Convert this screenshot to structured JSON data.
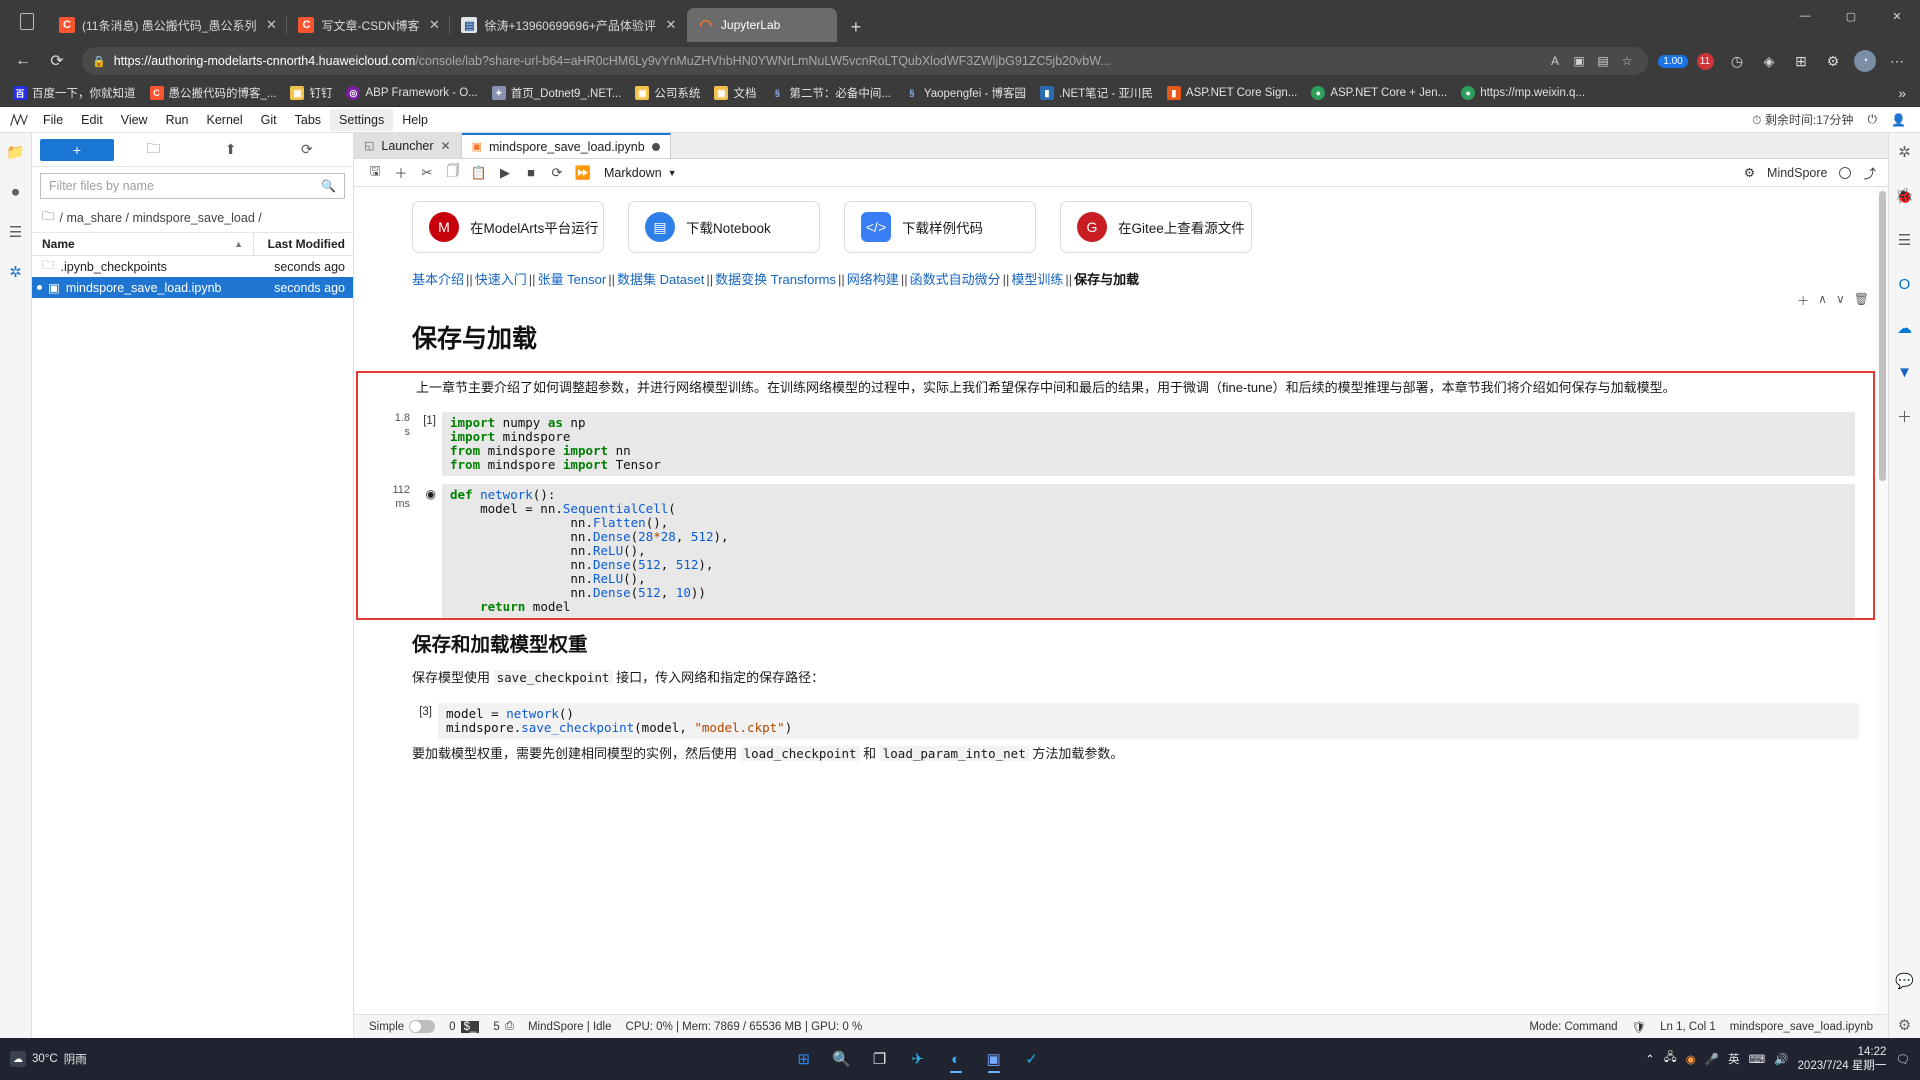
{
  "browser": {
    "tabs": [
      {
        "title": "(11条消息) 愚公搬代码_愚公系列",
        "favicon": "csdn-icon",
        "fav_text": "C",
        "active": false,
        "closable": true
      },
      {
        "title": "写文章-CSDN博客",
        "favicon": "csdn-icon",
        "fav_text": "C",
        "active": false,
        "closable": true
      },
      {
        "title": "徐涛+13960699696+产品体验评",
        "favicon": "document-icon",
        "fav_text": "▤",
        "active": false,
        "closable": true
      },
      {
        "title": "JupyterLab",
        "favicon": "jupyter-icon",
        "fav_text": "◠",
        "active": true,
        "closable": false
      }
    ],
    "new_tab_label": "+",
    "window_controls": [
      "—",
      "▢",
      "✕"
    ],
    "nav": {
      "back": "←",
      "refresh": "⟳",
      "lock": "🔒"
    },
    "url_host": "https://authoring-modelarts-cnnorth4.huaweicloud.com",
    "url_path": "/console/lab?share-url-b64=aHR0cHM6Ly9vYnMuZHVhbHN0YWNrLmNuLW5vcnRoLTQubXlodWF3ZWljbG91ZC5jb20vbW...",
    "omnibox_actions": [
      "A",
      "☆"
    ],
    "toolbar_badges": {
      "blue": "1.00",
      "red": "11"
    },
    "bookmarks": [
      {
        "label": "百度一下，你就知道",
        "icon": "baidu-icon",
        "color": "#2932e1",
        "glyph": "百"
      },
      {
        "label": "愚公搬代码的博客_...",
        "icon": "csdn-icon",
        "color": "#fc5531",
        "glyph": "C"
      },
      {
        "label": "钉钉",
        "icon": "folder-icon",
        "color": "#f2c14e",
        "glyph": "▣"
      },
      {
        "label": "ABP Framework - O...",
        "icon": "abp-icon",
        "color": "#7b1fa2",
        "glyph": "◎"
      },
      {
        "label": "首页_Dotnet9_.NET...",
        "icon": "dotnet-icon",
        "color": "#8892b0",
        "glyph": "✦"
      },
      {
        "label": "公司系统",
        "icon": "folder-icon",
        "color": "#f2c14e",
        "glyph": "▣"
      },
      {
        "label": "文档",
        "icon": "folder-icon",
        "color": "#f2c14e",
        "glyph": "▣"
      },
      {
        "label": "第二节：必备中间...",
        "icon": "link-icon",
        "color": "#4a9ae1",
        "glyph": "§"
      },
      {
        "label": "Yaopengfei - 博客园",
        "icon": "cnblogs-icon",
        "color": "#4a9ae1",
        "glyph": "§"
      },
      {
        "label": ".NET笔记 - 亚川民",
        "icon": "note-icon",
        "color": "#2b6cb0",
        "glyph": "▮"
      },
      {
        "label": "ASP.NET Core Sign...",
        "icon": "aspnet-icon",
        "color": "#e8591c",
        "glyph": "▮"
      },
      {
        "label": "ASP.NET Core + Jen...",
        "icon": "globe-icon",
        "color": "#2e9e5b",
        "glyph": "●"
      },
      {
        "label": "https://mp.weixin.q...",
        "icon": "wechat-icon",
        "color": "#2e9e5b",
        "glyph": "●"
      }
    ],
    "bookmarks_overflow": "»"
  },
  "jupyter": {
    "menus": [
      {
        "label": "File",
        "active": false
      },
      {
        "label": "Edit",
        "active": false
      },
      {
        "label": "View",
        "active": false
      },
      {
        "label": "Run",
        "active": false
      },
      {
        "label": "Kernel",
        "active": false
      },
      {
        "label": "Git",
        "active": false
      },
      {
        "label": "Tabs",
        "active": false
      },
      {
        "label": "Settings",
        "active": true
      },
      {
        "label": "Help",
        "active": false
      }
    ],
    "menubar_right": {
      "remaining_time": "剩余时间:17分钟",
      "power_icon": "power-icon",
      "user_icon": "user-icon"
    },
    "left_rail": [
      "folder-icon",
      "running-icon",
      "commands-icon",
      "extensions-icon"
    ],
    "filebrowser": {
      "new_button": "+",
      "tools": [
        "new-folder-icon",
        "upload-icon",
        "refresh-icon"
      ],
      "filter_placeholder": "Filter files by name",
      "breadcrumb": "/ ma_share / mindspore_save_load /",
      "columns": [
        "Name",
        "Last Modified"
      ],
      "rows": [
        {
          "name": ".ipynb_checkpoints",
          "modified": "seconds ago",
          "type": "folder",
          "selected": false
        },
        {
          "name": "mindspore_save_load.ipynb",
          "modified": "seconds ago",
          "type": "notebook",
          "selected": true
        }
      ]
    },
    "dock_tabs": [
      {
        "label": "Launcher",
        "icon": "launcher-icon",
        "active": false,
        "closable": true
      },
      {
        "label": "mindspore_save_load.ipynb",
        "icon": "notebook-icon",
        "active": true,
        "dirty": true
      }
    ],
    "notebook_toolbar": {
      "buttons": [
        "save-icon",
        "add-cell-icon",
        "cut-icon",
        "copy-icon",
        "paste-icon",
        "run-icon",
        "stop-icon",
        "restart-icon",
        "restart-run-all-icon"
      ],
      "cell_type": "Markdown",
      "kernel_name": "MindSpore",
      "kernel_status_icon": "kernel-idle-icon",
      "share_icon": "share-icon",
      "settings_icon": "gear-icon"
    },
    "quick_buttons": [
      {
        "label": "在ModelArts平台运行",
        "icon": "modelarts-icon"
      },
      {
        "label": "下载Notebook",
        "icon": "notebook-download-icon"
      },
      {
        "label": "下载样例代码",
        "icon": "code-download-icon"
      },
      {
        "label": "在Gitee上查看源文件",
        "icon": "gitee-icon"
      }
    ],
    "breadcrumb_links": [
      "基本介绍",
      "快速入门",
      "张量 Tensor",
      "数据集 Dataset",
      "数据变换 Transforms",
      "网络构建",
      "函数式自动微分",
      "模型训练"
    ],
    "breadcrumb_current": "保存与加载",
    "breadcrumb_separator": "||",
    "cell_toolbar_icons": [
      "add-icon",
      "move-up-icon",
      "move-down-icon",
      "delete-icon"
    ],
    "content": {
      "h1": "保存与加载",
      "intro": "上一章节主要介绍了如何调整超参数，并进行网络模型训练。在训练网络模型的过程中，实际上我们希望保存中间和最后的结果，用于微调（fine-tune）和后续的模型推理与部署，本章节我们将介绍如何保存与加载模型。",
      "cell1": {
        "time": "1.8",
        "time_unit": "s",
        "prompt": "[1]",
        "code_lines": [
          "import numpy as np",
          "import mindspore",
          "from mindspore import nn",
          "from mindspore import Tensor"
        ]
      },
      "cell2": {
        "time": "112",
        "time_unit": "ms",
        "prompt": "play-icon",
        "code_lines": [
          "def network():",
          "    model = nn.SequentialCell(",
          "                nn.Flatten(),",
          "                nn.Dense(28*28, 512),",
          "                nn.ReLU(),",
          "                nn.Dense(512, 512),",
          "                nn.ReLU(),",
          "                nn.Dense(512, 10))",
          "    return model"
        ]
      },
      "h2": "保存和加载模型权重",
      "para2_a": "保存模型使用 ",
      "para2_code": "save_checkpoint",
      "para2_b": " 接口，传入网络和指定的保存路径：",
      "cell3": {
        "prompt": "[3]",
        "code_lines": [
          "model = network()",
          "mindspore.save_checkpoint(model, \"model.ckpt\")"
        ]
      },
      "para3_a": "要加载模型权重，需要先创建相同模型的实例，然后使用 ",
      "para3_code1": "load_checkpoint",
      "para3_mid": " 和 ",
      "para3_code2": "load_param_into_net",
      "para3_b": " 方法加载参数。"
    },
    "status_bar": {
      "simple_label": "Simple",
      "terminals": "0",
      "kernels": "5",
      "kernel_info": "MindSpore | Idle",
      "resources": "CPU: 0% | Mem: 7869 / 65536 MB | GPU: 0 %",
      "mode": "Mode: Command",
      "cursor": "Ln 1, Col 1",
      "filename": "mindspore_save_load.ipynb"
    }
  },
  "taskbar": {
    "weather": {
      "temp": "30°C",
      "desc": "阴雨"
    },
    "apps": [
      "start-icon",
      "search-icon",
      "taskview-icon",
      "telegram-icon",
      "edge-icon",
      "jupyter-icon",
      "vscode-icon"
    ],
    "tray": [
      "chevron-up-icon",
      "network-icon",
      "sogou-icon",
      "mic-icon",
      "lang-英",
      "keyboard-icon",
      "volume-icon"
    ],
    "lang": "英",
    "clock_time": "14:22",
    "clock_date": "2023/7/24 星期一"
  }
}
